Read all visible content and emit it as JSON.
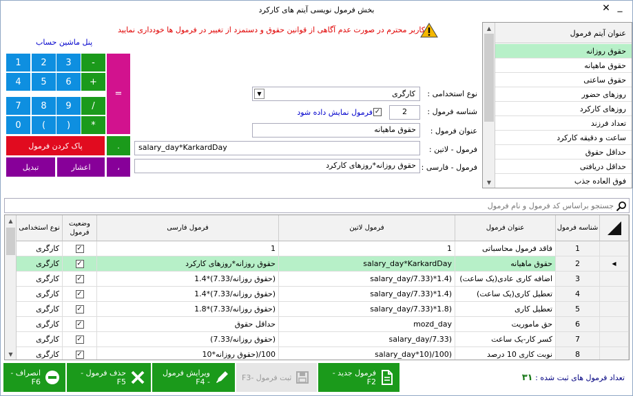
{
  "window": {
    "title": "بخش فرمول نویسی آیتم های کارکرد"
  },
  "warning": "کاربر محترم در صورت عدم آگاهی از قوانین حقوق و دستمزد از تغییر در فرمول ها خودداری نمایید",
  "calculator": {
    "label": "پنل ماشین حساب",
    "keys": [
      "1",
      "2",
      "3",
      "-",
      "4",
      "5",
      "6",
      "+",
      "7",
      "8",
      "9",
      "/",
      "0",
      "(",
      ")",
      "*",
      "="
    ],
    "dot": ".",
    "comma": "،",
    "clear_label": "پاک کردن فرمول",
    "decimal_label": "اعشار",
    "convert_label": "تبدیل"
  },
  "form": {
    "type_label": "نوع استخدامی :",
    "type_value": "کارگری",
    "id_label": "شناسه فرمول :",
    "id_value": "2",
    "show_formula_label": "فرمول نمایش داده شود",
    "title_label": "عنوان فرمول :",
    "title_value": "حقوق ماهیانه",
    "latin_label": "فرمول - لاتین :",
    "latin_value": "salary_day*KarkardDay",
    "farsi_label": "فرمول - فارسی :",
    "farsi_value": "حقوق روزانه*روزهای کارکرد"
  },
  "item_list": {
    "header": "عنوان آیتم فرمول",
    "items": [
      "حقوق روزانه",
      "حقوق ماهیانه",
      "حقوق ساعتی",
      "روزهای حضور",
      "روزهای کارکرد",
      "تعداد فرزند",
      "ساعت و دقیقه کارکرد",
      "حداقل حقوق",
      "حداقل دریافتی",
      "فوق العاده جذب"
    ],
    "selected_index": 0
  },
  "search": {
    "placeholder": "جستجو براساس کد فرمول و نام فرمول"
  },
  "grid": {
    "columns": {
      "id": "شناسه فرمول",
      "title": "عنوان فرمول",
      "latin": "فرمول لاتین",
      "farsi": "فرمول فارسی",
      "status": "وضعیت فرمول",
      "type": "نوع استخدامی"
    },
    "rows": [
      {
        "id": "1",
        "title": "فاقد فرمول محاسباتی",
        "latin": "1",
        "farsi": "1",
        "type": "کارگری"
      },
      {
        "id": "2",
        "title": "حقوق ماهیانه",
        "latin": "salary_day*KarkardDay",
        "farsi": "حقوق روزانه*روزهای کارکرد",
        "type": "کارگری"
      },
      {
        "id": "3",
        "title": "اضافه کاری عادی(یک ساعت)",
        "latin": "salary_day/7.33)*1.4)",
        "farsi": "(حقوق روزانه/7.33)*1.4",
        "type": "کارگری"
      },
      {
        "id": "4",
        "title": "تعطیل کاری(یک ساعت)",
        "latin": "salary_day/7.33)*1.4)",
        "farsi": "(حقوق روزانه/7.33)*1.4",
        "type": "کارگری"
      },
      {
        "id": "5",
        "title": "تعطیل کاری",
        "latin": "salary_day/7.33)*1.8)",
        "farsi": "(حقوق روزانه/7.33)*1.8",
        "type": "کارگری"
      },
      {
        "id": "6",
        "title": "حق ماموریت",
        "latin": "mozd_day",
        "farsi": "حداقل حقوق",
        "type": "کارگری"
      },
      {
        "id": "7",
        "title": "کسر کار-یک ساعت",
        "latin": "salary_day/7.33)",
        "farsi": "(حقوق روزانه/7.33)",
        "type": "کارگری"
      },
      {
        "id": "8",
        "title": "نوبت کاری 10 درصد",
        "latin": "salary_day*10)/100)",
        "farsi": "100/(حقوق روزانه*10",
        "type": "کارگری"
      }
    ],
    "selected_index": 1
  },
  "buttons": {
    "new": "فرمول جدید - F2",
    "save": "ثبت فرمول -F3",
    "edit": "ویرایش فرمول - F4",
    "delete": "حذف فرمول - F5",
    "cancel": "انصراف - F6"
  },
  "count": {
    "label": "تعداد فرمول های ثبت شده :",
    "value": "۳۱"
  }
}
